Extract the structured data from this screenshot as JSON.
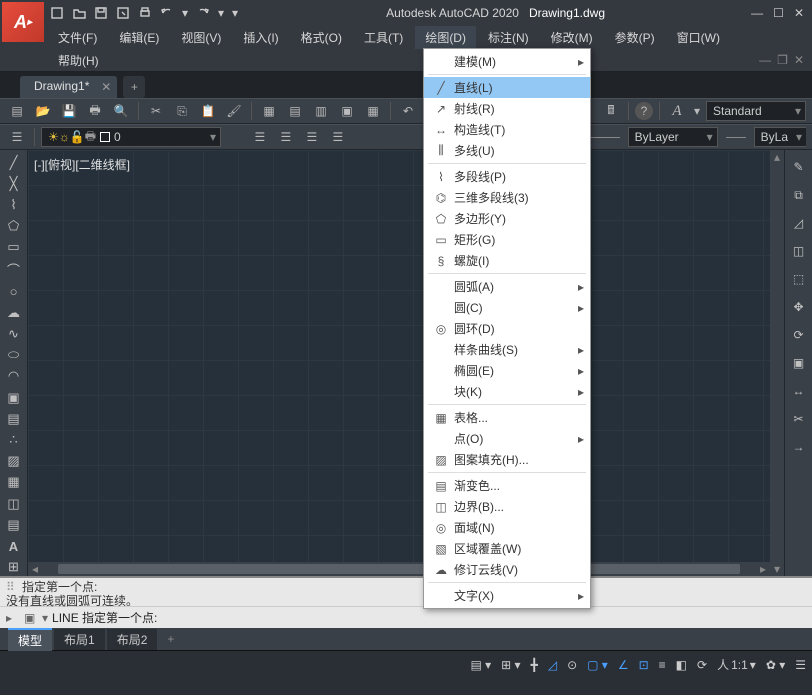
{
  "app_title": "Autodesk AutoCAD 2020",
  "file_name": "Drawing1.dwg",
  "menubar": [
    "文件(F)",
    "编辑(E)",
    "视图(V)",
    "插入(I)",
    "格式(O)",
    "工具(T)",
    "绘图(D)",
    "标注(N)",
    "修改(M)",
    "参数(P)",
    "窗口(W)"
  ],
  "menubar2": [
    "帮助(H)"
  ],
  "open_menu_index": 6,
  "doc_tab": "Drawing1*",
  "style_combo": "Standard",
  "layer_combo": "ByLayer",
  "layer_combo2": "ByLa",
  "layer_name": "0",
  "viewport_label": "[-][俯视][二维线框]",
  "cmd_hist_1": "指定第一个点:",
  "cmd_hist_2": "没有直线或圆弧可连续。",
  "cmd_line": "LINE 指定第一个点:",
  "layout_tabs": [
    "模型",
    "布局1",
    "布局2"
  ],
  "layout_active": 0,
  "status_scale": "1:1",
  "dropdown": {
    "items": [
      {
        "label": "建模(M)",
        "sub": true,
        "icon": ""
      },
      {
        "sep": true
      },
      {
        "label": "直线(L)",
        "icon": "line",
        "hl": true
      },
      {
        "label": "射线(R)",
        "icon": "ray"
      },
      {
        "label": "构造线(T)",
        "icon": "xline"
      },
      {
        "label": "多线(U)",
        "icon": "mline"
      },
      {
        "sep": true
      },
      {
        "label": "多段线(P)",
        "icon": "pline"
      },
      {
        "label": "三维多段线(3)",
        "icon": "3dpoly"
      },
      {
        "label": "多边形(Y)",
        "icon": "polygon"
      },
      {
        "label": "矩形(G)",
        "icon": "rect"
      },
      {
        "label": "螺旋(I)",
        "icon": "helix"
      },
      {
        "sep": true
      },
      {
        "label": "圆弧(A)",
        "sub": true,
        "icon": ""
      },
      {
        "label": "圆(C)",
        "sub": true,
        "icon": ""
      },
      {
        "label": "圆环(D)",
        "icon": "donut"
      },
      {
        "label": "样条曲线(S)",
        "sub": true,
        "icon": ""
      },
      {
        "label": "椭圆(E)",
        "sub": true,
        "icon": ""
      },
      {
        "label": "块(K)",
        "sub": true,
        "icon": ""
      },
      {
        "sep": true
      },
      {
        "label": "表格...",
        "icon": "table"
      },
      {
        "label": "点(O)",
        "sub": true,
        "icon": ""
      },
      {
        "label": "图案填充(H)...",
        "icon": "hatch"
      },
      {
        "sep": true
      },
      {
        "label": "渐变色...",
        "icon": "gradient"
      },
      {
        "label": "边界(B)...",
        "icon": "boundary"
      },
      {
        "label": "面域(N)",
        "icon": "region"
      },
      {
        "label": "区域覆盖(W)",
        "icon": "wipeout"
      },
      {
        "label": "修订云线(V)",
        "icon": "revcloud"
      },
      {
        "sep": true
      },
      {
        "label": "文字(X)",
        "sub": true,
        "icon": ""
      }
    ]
  }
}
